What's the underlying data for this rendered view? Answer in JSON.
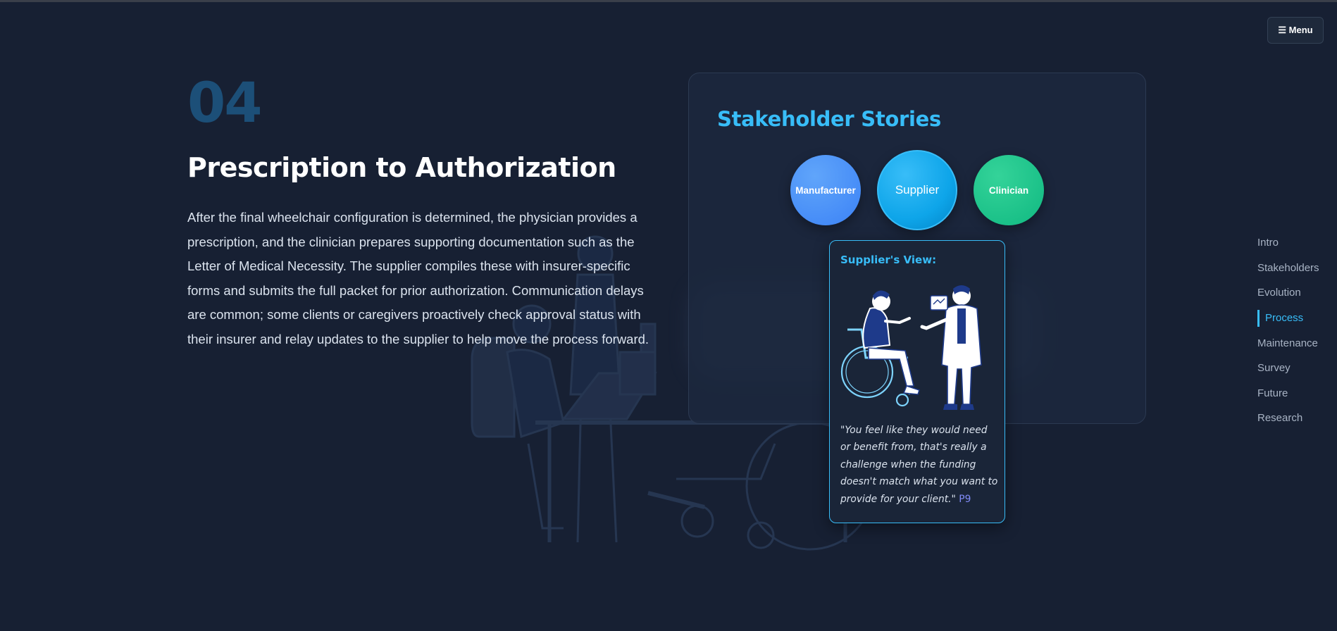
{
  "menu": {
    "icon": "hamburger-icon",
    "label": "☰ Menu"
  },
  "section": {
    "number": "04",
    "title": "Prescription to Authorization",
    "body": "After the final wheelchair configuration is determined, the physician provides a prescription, and the clinician prepares supporting documentation such as the Letter of Medical Necessity. The supplier compiles these with insurer-specific forms and submits the full packet for prior authorization. Communication delays are common; some clients or caregivers proactively check approval status with their insurer and relay updates to the supplier to help move the process forward."
  },
  "stakeholders": {
    "title": "Stakeholder Stories",
    "roles": [
      "Manufacturer",
      "Supplier",
      "Clinician"
    ],
    "selected": "Supplier",
    "view": {
      "title": "Supplier's View:",
      "quote": "\"You feel like they would need or benefit from, that's really a challenge when the funding doesn't match what you want to provide for your client.\"",
      "ref": "P9"
    }
  },
  "nav": {
    "items": [
      "Intro",
      "Stakeholders",
      "Evolution",
      "Process",
      "Maintenance",
      "Survey",
      "Future",
      "Research"
    ],
    "active": "Process"
  },
  "colors": {
    "background": "#172033",
    "accent": "#38bdf8",
    "manufacturer": "#3b82f6",
    "supplier": "#0ea5e9",
    "clinician": "#10b981"
  }
}
